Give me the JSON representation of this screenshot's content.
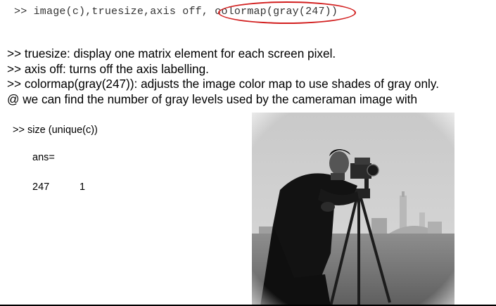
{
  "code": {
    "prefix": ">> image(c),truesize,axis off, ",
    "highlight": "colormap(gray(247))"
  },
  "explanations": [
    ">> truesize: display one matrix element for each screen pixel.",
    ">> axis off: turns off the axis labelling.",
    ">> colormap(gray(247)): adjusts the image color map to use shades of gray only.",
    "@ we can find the number of gray levels used by the cameraman image with"
  ],
  "command": ">> size (unique(c))",
  "ans_label": "ans=",
  "ans_values": [
    "247",
    "1"
  ],
  "colors": {
    "highlight_ring": "#d21f1f"
  }
}
